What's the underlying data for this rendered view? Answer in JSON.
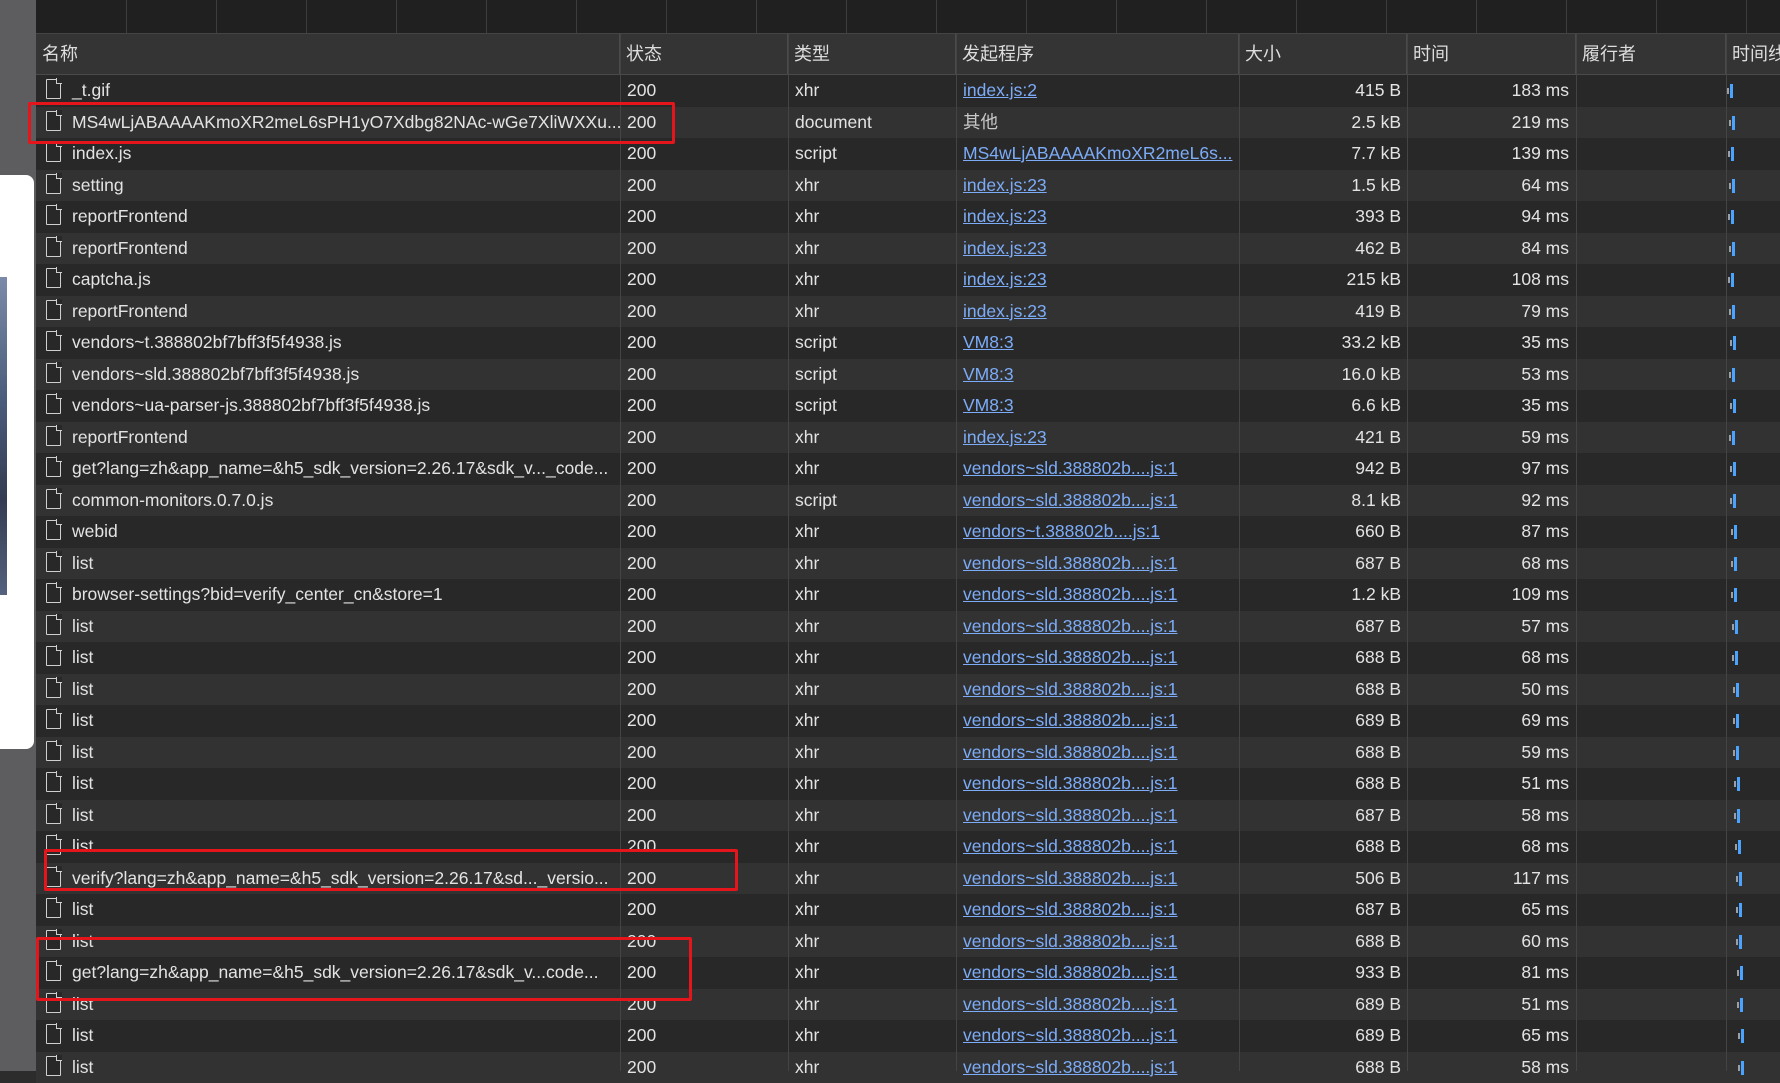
{
  "columns": {
    "name": "名称",
    "status": "状态",
    "type": "类型",
    "initiator": "发起程序",
    "size": "大小",
    "time": "时间",
    "fulfilled_by": "履行者",
    "waterfall": "时间线"
  },
  "colors": {
    "highlight": "#e5161b",
    "link": "#7cacf8",
    "waterfall_bar": "#4aa3ff"
  },
  "rows": [
    {
      "name": "_t.gif",
      "status": "200",
      "type": "xhr",
      "initiator": "index.js:2",
      "initiator_link": true,
      "size": "415 B",
      "time": "183 ms"
    },
    {
      "name": "MS4wLjABAAAAKmoXR2meL6sPH1yO7Xdbg82NAc-wGe7XliWXXu...",
      "status": "200",
      "type": "document",
      "initiator": "其他",
      "initiator_link": false,
      "size": "2.5 kB",
      "time": "219 ms"
    },
    {
      "name": "index.js",
      "status": "200",
      "type": "script",
      "initiator": "MS4wLjABAAAAKmoXR2meL6s...",
      "initiator_link": true,
      "size": "7.7 kB",
      "time": "139 ms"
    },
    {
      "name": "setting",
      "status": "200",
      "type": "xhr",
      "initiator": "index.js:23",
      "initiator_link": true,
      "size": "1.5 kB",
      "time": "64 ms"
    },
    {
      "name": "reportFrontend",
      "status": "200",
      "type": "xhr",
      "initiator": "index.js:23",
      "initiator_link": true,
      "size": "393 B",
      "time": "94 ms"
    },
    {
      "name": "reportFrontend",
      "status": "200",
      "type": "xhr",
      "initiator": "index.js:23",
      "initiator_link": true,
      "size": "462 B",
      "time": "84 ms"
    },
    {
      "name": "captcha.js",
      "status": "200",
      "type": "xhr",
      "initiator": "index.js:23",
      "initiator_link": true,
      "size": "215 kB",
      "time": "108 ms"
    },
    {
      "name": "reportFrontend",
      "status": "200",
      "type": "xhr",
      "initiator": "index.js:23",
      "initiator_link": true,
      "size": "419 B",
      "time": "79 ms"
    },
    {
      "name": "vendors~t.388802bf7bff3f5f4938.js",
      "status": "200",
      "type": "script",
      "initiator": "VM8:3",
      "initiator_link": true,
      "size": "33.2 kB",
      "time": "35 ms"
    },
    {
      "name": "vendors~sld.388802bf7bff3f5f4938.js",
      "status": "200",
      "type": "script",
      "initiator": "VM8:3",
      "initiator_link": true,
      "size": "16.0 kB",
      "time": "53 ms"
    },
    {
      "name": "vendors~ua-parser-js.388802bf7bff3f5f4938.js",
      "status": "200",
      "type": "script",
      "initiator": "VM8:3",
      "initiator_link": true,
      "size": "6.6 kB",
      "time": "35 ms"
    },
    {
      "name": "reportFrontend",
      "status": "200",
      "type": "xhr",
      "initiator": "index.js:23",
      "initiator_link": true,
      "size": "421 B",
      "time": "59 ms"
    },
    {
      "name": "get?lang=zh&app_name=&h5_sdk_version=2.26.17&sdk_v..._code...",
      "status": "200",
      "type": "xhr",
      "initiator": "vendors~sld.388802b....js:1",
      "initiator_link": true,
      "size": "942 B",
      "time": "97 ms"
    },
    {
      "name": "common-monitors.0.7.0.js",
      "status": "200",
      "type": "script",
      "initiator": "vendors~sld.388802b....js:1",
      "initiator_link": true,
      "size": "8.1 kB",
      "time": "92 ms"
    },
    {
      "name": "webid",
      "status": "200",
      "type": "xhr",
      "initiator": "vendors~t.388802b....js:1",
      "initiator_link": true,
      "size": "660 B",
      "time": "87 ms"
    },
    {
      "name": "list",
      "status": "200",
      "type": "xhr",
      "initiator": "vendors~sld.388802b....js:1",
      "initiator_link": true,
      "size": "687 B",
      "time": "68 ms"
    },
    {
      "name": "browser-settings?bid=verify_center_cn&store=1",
      "status": "200",
      "type": "xhr",
      "initiator": "vendors~sld.388802b....js:1",
      "initiator_link": true,
      "size": "1.2 kB",
      "time": "109 ms"
    },
    {
      "name": "list",
      "status": "200",
      "type": "xhr",
      "initiator": "vendors~sld.388802b....js:1",
      "initiator_link": true,
      "size": "687 B",
      "time": "57 ms"
    },
    {
      "name": "list",
      "status": "200",
      "type": "xhr",
      "initiator": "vendors~sld.388802b....js:1",
      "initiator_link": true,
      "size": "688 B",
      "time": "68 ms"
    },
    {
      "name": "list",
      "status": "200",
      "type": "xhr",
      "initiator": "vendors~sld.388802b....js:1",
      "initiator_link": true,
      "size": "688 B",
      "time": "50 ms"
    },
    {
      "name": "list",
      "status": "200",
      "type": "xhr",
      "initiator": "vendors~sld.388802b....js:1",
      "initiator_link": true,
      "size": "689 B",
      "time": "69 ms"
    },
    {
      "name": "list",
      "status": "200",
      "type": "xhr",
      "initiator": "vendors~sld.388802b....js:1",
      "initiator_link": true,
      "size": "688 B",
      "time": "59 ms"
    },
    {
      "name": "list",
      "status": "200",
      "type": "xhr",
      "initiator": "vendors~sld.388802b....js:1",
      "initiator_link": true,
      "size": "688 B",
      "time": "51 ms"
    },
    {
      "name": "list",
      "status": "200",
      "type": "xhr",
      "initiator": "vendors~sld.388802b....js:1",
      "initiator_link": true,
      "size": "687 B",
      "time": "58 ms"
    },
    {
      "name": "list",
      "status": "200",
      "type": "xhr",
      "initiator": "vendors~sld.388802b....js:1",
      "initiator_link": true,
      "size": "688 B",
      "time": "68 ms"
    },
    {
      "name": "verify?lang=zh&app_name=&h5_sdk_version=2.26.17&sd..._versio...",
      "status": "200",
      "type": "xhr",
      "initiator": "vendors~sld.388802b....js:1",
      "initiator_link": true,
      "size": "506 B",
      "time": "117 ms"
    },
    {
      "name": "list",
      "status": "200",
      "type": "xhr",
      "initiator": "vendors~sld.388802b....js:1",
      "initiator_link": true,
      "size": "687 B",
      "time": "65 ms"
    },
    {
      "name": "list",
      "status": "200",
      "type": "xhr",
      "initiator": "vendors~sld.388802b....js:1",
      "initiator_link": true,
      "size": "688 B",
      "time": "60 ms"
    },
    {
      "name": "get?lang=zh&app_name=&h5_sdk_version=2.26.17&sdk_v...code...",
      "status": "200",
      "type": "xhr",
      "initiator": "vendors~sld.388802b....js:1",
      "initiator_link": true,
      "size": "933 B",
      "time": "81 ms"
    },
    {
      "name": "list",
      "status": "200",
      "type": "xhr",
      "initiator": "vendors~sld.388802b....js:1",
      "initiator_link": true,
      "size": "689 B",
      "time": "51 ms"
    },
    {
      "name": "list",
      "status": "200",
      "type": "xhr",
      "initiator": "vendors~sld.388802b....js:1",
      "initiator_link": true,
      "size": "689 B",
      "time": "65 ms"
    },
    {
      "name": "list",
      "status": "200",
      "type": "xhr",
      "initiator": "vendors~sld.388802b....js:1",
      "initiator_link": true,
      "size": "688 B",
      "time": "58 ms"
    }
  ]
}
